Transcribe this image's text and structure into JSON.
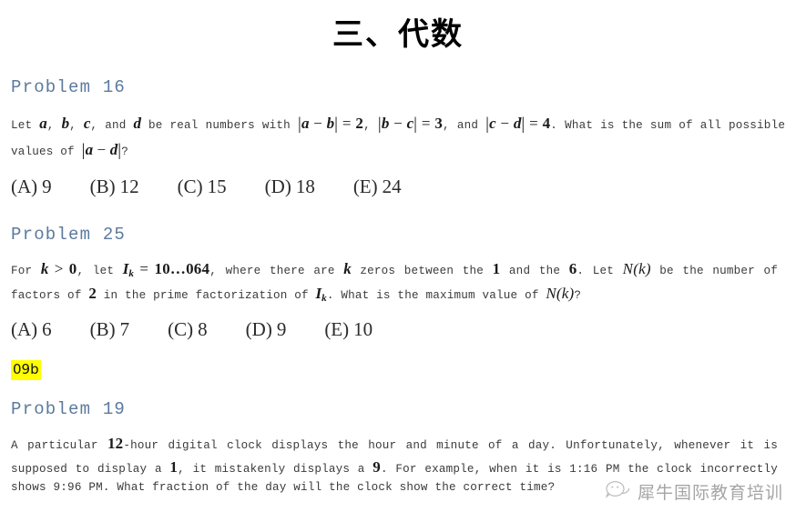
{
  "document": {
    "title": "三、代数",
    "watermark": {
      "text": "犀牛国际教育培训",
      "icon": "wechat-icon"
    },
    "tag": {
      "label": "09b",
      "highlight_color": "#ffff00"
    },
    "heading_color": "#5b7a9d"
  },
  "problems": [
    {
      "heading": "Problem 16",
      "body_plain": "Let a, b, c, and d be real numbers with |a − b| = 2, |b − c| = 3, and |c − d| = 4. What is the sum of all possible values of |a − d|?",
      "parts": {
        "t1": "Let ",
        "v1": "a",
        "c1": ", ",
        "v2": "b",
        "c2": ", ",
        "v3": "c",
        "c3": ", ",
        "t2": "and ",
        "v4": "d",
        "t3": " be real numbers with ",
        "eq1_open": "|",
        "eq1_a": "a",
        "eq1_minus": " − ",
        "eq1_b": "b",
        "eq1_close": "|",
        "eq1_rel": " = ",
        "eq1_val": "2",
        "t4": ", ",
        "eq2_open": "|",
        "eq2_a": "b",
        "eq2_minus": " − ",
        "eq2_b": "c",
        "eq2_close": "|",
        "eq2_rel": " = ",
        "eq2_val": "3",
        "t5": ", and ",
        "eq3_open": "|",
        "eq3_a": "c",
        "eq3_minus": " − ",
        "eq3_b": "d",
        "eq3_close": "|",
        "eq3_rel": " = ",
        "eq3_val": "4",
        "t6": ". What is the sum of all possible values of ",
        "eq4_open": "|",
        "eq4_a": "a",
        "eq4_minus": " − ",
        "eq4_b": "d",
        "eq4_close": "|",
        "t7": "?"
      },
      "choices": [
        {
          "letter": "(A)",
          "value": "9"
        },
        {
          "letter": "(B)",
          "value": "12"
        },
        {
          "letter": "(C)",
          "value": "15"
        },
        {
          "letter": "(D)",
          "value": "18"
        },
        {
          "letter": "(E)",
          "value": "24"
        }
      ]
    },
    {
      "heading": "Problem 25",
      "body_plain": "For k > 0, let I_k = 10…064, where there are k zeros between the 1 and the 6. Let N(k) be the number of factors of 2 in the prime factorization of I_k. What is the maximum value of N(k)?",
      "parts": {
        "t1": "For ",
        "k1": "k",
        "rel1": " > ",
        "zero": "0",
        "t2": ", let ",
        "ik1": "I",
        "ik1sub": "k",
        "rel2": " = ",
        "num": "10…064",
        "t3": ", where there are ",
        "k2": "k",
        "t4": " zeros between the ",
        "one": "1",
        "t5": " and the ",
        "six": "6",
        "t6": ". Let ",
        "nk1": "N(k)",
        "t7": " be the number of factors of ",
        "two": "2",
        "t8": " in the prime factorization of ",
        "ik2": "I",
        "ik2sub": "k",
        "t9": ". What is the maximum value of ",
        "nk2": "N(k)",
        "t10": "?"
      },
      "choices": [
        {
          "letter": "(A)",
          "value": "6"
        },
        {
          "letter": "(B)",
          "value": "7"
        },
        {
          "letter": "(C)",
          "value": "8"
        },
        {
          "letter": "(D)",
          "value": "9"
        },
        {
          "letter": "(E)",
          "value": "10"
        }
      ]
    },
    {
      "heading": "Problem 19",
      "body_plain": "A particular 12-hour digital clock displays the hour and minute of a day. Unfortunately, whenever it is supposed to display a 1, it mistakenly displays a 9. For example, when it is 1:16 PM the clock incorrectly shows 9:96 PM. What fraction of the day will the clock show the correct time?",
      "parts": {
        "t1": "A particular ",
        "twelve": "12",
        "t2": "-hour digital clock displays the hour and minute of a day. Unfortunately, whenever it is supposed to display a ",
        "one": "1",
        "t3": ", it mistakenly displays a ",
        "nine": "9",
        "t4": ". For example, when it is 1:16 PM the clock incorrectly shows 9:96 PM. What fraction of the day will the clock show the correct time?"
      },
      "choices": []
    }
  ]
}
